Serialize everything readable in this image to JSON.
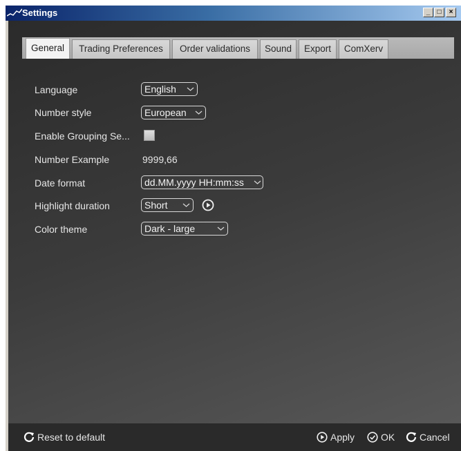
{
  "window": {
    "title": "Settings"
  },
  "titlebar_buttons": {
    "minimize": "_",
    "maximize": "□",
    "close": "×"
  },
  "tabs": [
    {
      "label": "General",
      "active": true
    },
    {
      "label": "Trading Preferences",
      "active": false
    },
    {
      "label": "Order validations",
      "active": false
    },
    {
      "label": "Sound",
      "active": false
    },
    {
      "label": "Export",
      "active": false
    },
    {
      "label": "ComXerv",
      "active": false
    }
  ],
  "general": {
    "language": {
      "label": "Language",
      "value": "English"
    },
    "number_style": {
      "label": "Number style",
      "value": "European"
    },
    "grouping": {
      "label": "Enable Grouping Se...",
      "checked": false
    },
    "number_example": {
      "label": "Number Example",
      "value": "9999,66"
    },
    "date_format": {
      "label": "Date format",
      "value": "dd.MM.yyyy HH:mm:ss"
    },
    "highlight": {
      "label": "Highlight duration",
      "value": "Short"
    },
    "color_theme": {
      "label": "Color theme",
      "value": "Dark - large"
    }
  },
  "footer": {
    "reset_label": "Reset to default",
    "apply_label": "Apply",
    "ok_label": "OK",
    "cancel_label": "Cancel"
  },
  "icons": {
    "app": "chart-line-icon",
    "dropdown": "chevron-down-icon",
    "play": "play-circle-icon",
    "reset": "refresh-icon",
    "apply": "play-circle-icon",
    "ok": "check-circle-icon",
    "cancel": "refresh-icon"
  },
  "colors": {
    "titlebar_start": "#0a246a",
    "titlebar_end": "#a6caf0",
    "panel_dark": "#2b2b2b",
    "text_light": "#e6e6e6"
  }
}
